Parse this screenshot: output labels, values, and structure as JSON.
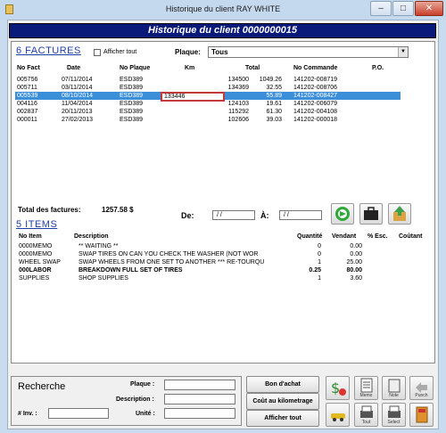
{
  "window": {
    "title": "Historique du client RAY WHITE"
  },
  "banner": {
    "text": "Historique du client 0000000015"
  },
  "factures": {
    "title": "6  FACTURES",
    "afficher_tout": "Afficher tout",
    "plaque_label": "Plaque:",
    "plaque_value": "Tous",
    "columns": [
      "No Fact",
      "Date",
      "No Plaque",
      "Km",
      "Total",
      "No Commande",
      "P.O."
    ],
    "rows": [
      [
        "005756",
        "07/11/2014",
        "ESD389",
        "134500",
        "1049.26",
        "141202-008719",
        ""
      ],
      [
        "005711",
        "03/11/2014",
        "ESD389",
        "134369",
        "32.55",
        "141202-008706",
        ""
      ],
      [
        "005539",
        "08/10/2014",
        "ESD389",
        "",
        "55.89",
        "141202-008427",
        ""
      ],
      [
        "004116",
        "11/04/2014",
        "ESD389",
        "124103",
        "19.61",
        "141202-006079",
        ""
      ],
      [
        "002837",
        "20/11/2013",
        "ESD389",
        "115292",
        "61.30",
        "141202-004108",
        ""
      ],
      [
        "000011",
        "27/02/2013",
        "ESD389",
        "102606",
        "39.03",
        "141202-000018",
        ""
      ]
    ],
    "selected_row": 2,
    "edit_value": "133446",
    "total_label": "Total des factures:",
    "total_value": "1257.58 $",
    "de_label": "De:",
    "a_label": "À:",
    "de_value": "/ /",
    "a_value": "/ /"
  },
  "items": {
    "title": "5  ITEMS",
    "columns": [
      "No Item",
      "Description",
      "Quantité",
      "Vendant",
      "% Esc.",
      "Coûtant"
    ],
    "rows": [
      {
        "no": "0000MEMO",
        "desc": "** WAITING **",
        "qty": "0",
        "price": "0.00",
        "bold": false
      },
      {
        "no": "0000MEMO",
        "desc": "SWAP TIRES ON    CAN YOU CHECK THE WASHER (NOT WOR",
        "qty": "0",
        "price": "0.00",
        "bold": false
      },
      {
        "no": "WHEEL SWAP",
        "desc": "SWAP WHEELS FROM ONE SET TO ANOTHER  *** RE-TOURQU",
        "qty": "1",
        "price": "25.00",
        "bold": false
      },
      {
        "no": "000LABOR",
        "desc": "BREAKDOWN FULL SET OF TIRES",
        "qty": "0.25",
        "price": "80.00",
        "bold": true
      },
      {
        "no": "SUPPLIES",
        "desc": "SHOP SUPPLIES",
        "qty": "1",
        "price": "3.60",
        "bold": false
      }
    ]
  },
  "search": {
    "title": "Recherche",
    "plaque_label": "Plaque :",
    "description_label": "Description :",
    "inv_label": "# Inv. :",
    "unite_label": "Unité :"
  },
  "buttons": {
    "bon_achat": "Bon d'achat",
    "cout_km": "Coût au kilometrage",
    "afficher_tout": "Afficher tout",
    "memo": "Memo",
    "note": "Note",
    "punch": "Punch",
    "tout": "Tout",
    "select": "Select"
  },
  "colors": {
    "banner": "#0a1a7a",
    "selection": "#3b8fd8",
    "accent_title": "#1f3fa8"
  }
}
